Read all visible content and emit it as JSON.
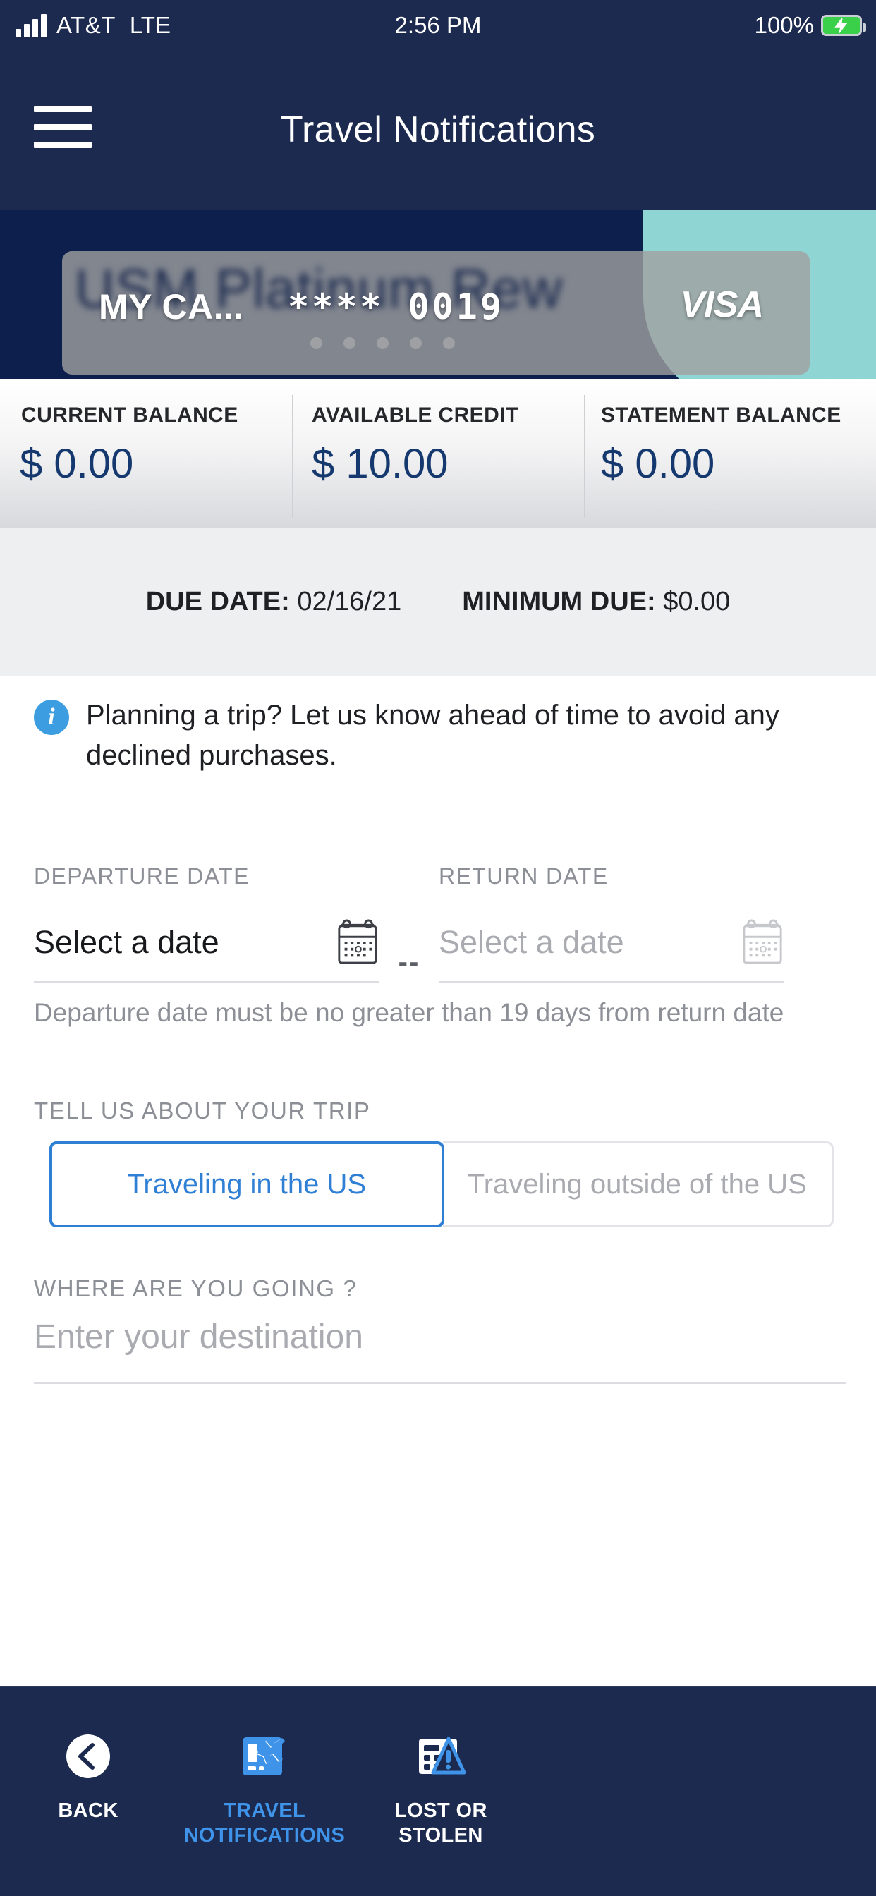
{
  "status_bar": {
    "carrier": "AT&T",
    "network": "LTE",
    "time": "2:56 PM",
    "battery_percent": "100%",
    "signal_icon": "signal-bars-icon",
    "battery_icon": "battery-charging-icon"
  },
  "header": {
    "menu_icon": "hamburger-menu-icon",
    "title": "Travel Notifications"
  },
  "card": {
    "background_text": "USM Platinum Rew",
    "name": "MY CA...",
    "masked_number": "**** 0019",
    "brand": "VISA",
    "carousel_dots": 5,
    "colors": {
      "navy": "#0c1f4d",
      "teal": "#8fd5d4",
      "card_overlay": "#a0a0a0"
    }
  },
  "balances": [
    {
      "label": "CURRENT BALANCE",
      "value": "$ 0.00"
    },
    {
      "label": "AVAILABLE CREDIT",
      "value": "$ 10.00"
    },
    {
      "label": "STATEMENT BALANCE",
      "value": "$ 0.00"
    }
  ],
  "due_row": {
    "due_date_label": "DUE DATE:",
    "due_date_value": "02/16/21",
    "minimum_due_label": "MINIMUM DUE:",
    "minimum_due_value": "$0.00"
  },
  "info_banner": {
    "icon": "info-circle-icon",
    "text": "Planning a trip? Let us know ahead of time to avoid any declined purchases.",
    "icon_color": "#3c9ee0"
  },
  "dates": {
    "departure_label": "DEPARTURE DATE",
    "departure_value": "Select a date",
    "separator": "--",
    "return_label": "RETURN DATE",
    "return_value": "Select a date",
    "calendar_icon": "calendar-icon",
    "helper_text": "Departure date must be no greater than 19 days from return date"
  },
  "trip": {
    "label": "TELL US ABOUT YOUR TRIP",
    "options": [
      {
        "label": "Traveling in the US",
        "selected": true
      },
      {
        "label": "Traveling outside of the US",
        "selected": false
      }
    ],
    "accent_color": "#2f7fd4"
  },
  "destination": {
    "label": "WHERE ARE YOU GOING ?",
    "placeholder": "Enter your destination",
    "value": ""
  },
  "bottom_nav": [
    {
      "icon": "back-chevron-icon",
      "label": "BACK",
      "active": false
    },
    {
      "icon": "travel-notifications-icon",
      "label": "TRAVEL NOTIFICATIONS",
      "active": true
    },
    {
      "icon": "lost-or-stolen-icon",
      "label": "LOST OR STOLEN",
      "active": false
    }
  ]
}
